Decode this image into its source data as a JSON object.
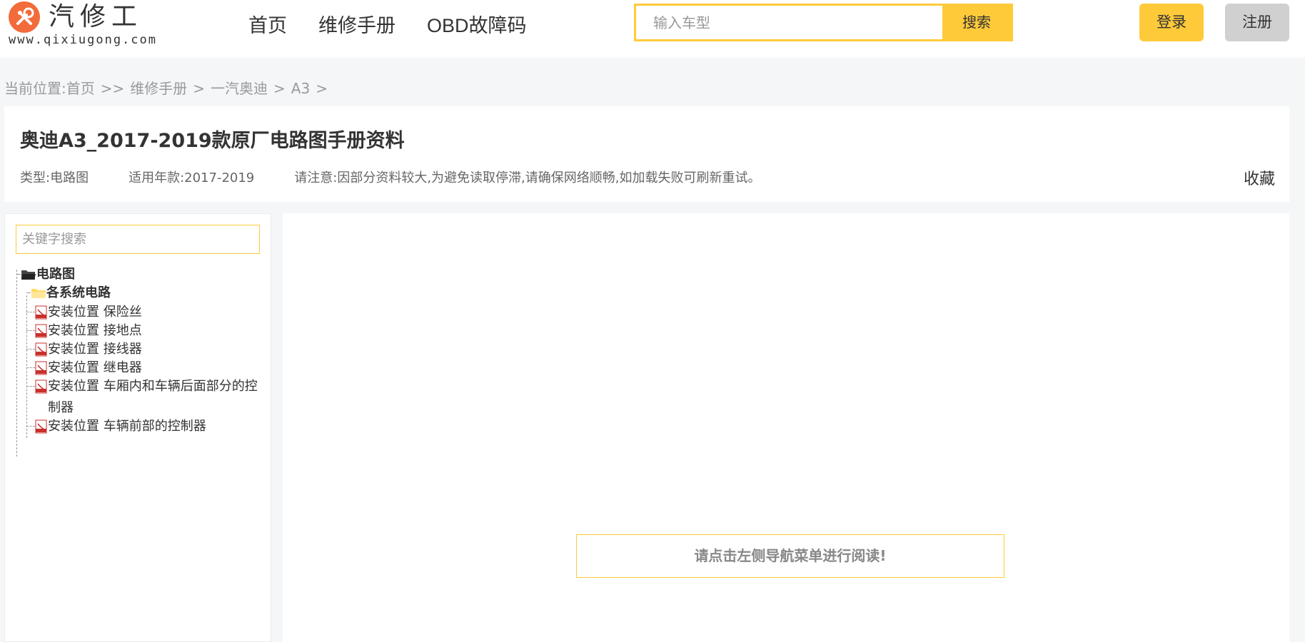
{
  "header": {
    "logo_name": "汽修工",
    "logo_url": "www.qixiugong.com",
    "nav": [
      {
        "label": "首页"
      },
      {
        "label": "维修手册"
      },
      {
        "label": "OBD故障码"
      }
    ],
    "search": {
      "placeholder": "输入车型",
      "value": "",
      "button_label": "搜索"
    },
    "login_label": "登录",
    "register_label": "注册"
  },
  "breadcrumb": {
    "prefix": "当前位置:",
    "items": [
      "首页",
      ">>",
      "维修手册",
      ">",
      "一汽奥迪",
      ">",
      "A3",
      ">"
    ]
  },
  "doc": {
    "title": "奥迪A3_2017-2019款原厂电路图手册资料",
    "type": "类型:电路图",
    "years": "适用年款:2017-2019",
    "notice": "请注意:因部分资料较大,为避免读取停滞,请确保网络顺畅,如加载失败可刷新重试。",
    "favorite_label": "收藏"
  },
  "sidebar": {
    "search_placeholder": "关键字搜索",
    "root": "电路图",
    "folder": "各系统电路",
    "files": [
      "安装位置 保险丝",
      "安装位置 接地点",
      "安装位置 接线器",
      "安装位置 继电器",
      "安装位置 车厢内和车辆后面部分的控制器",
      "安装位置 车辆前部的控制器"
    ]
  },
  "content": {
    "hint": "请点击左侧导航菜单进行阅读!"
  },
  "colors": {
    "accent": "#ffca3a",
    "logo": "#f26b3a",
    "register_bg": "#d0d0d0",
    "page_bg": "#f5f6f8"
  }
}
